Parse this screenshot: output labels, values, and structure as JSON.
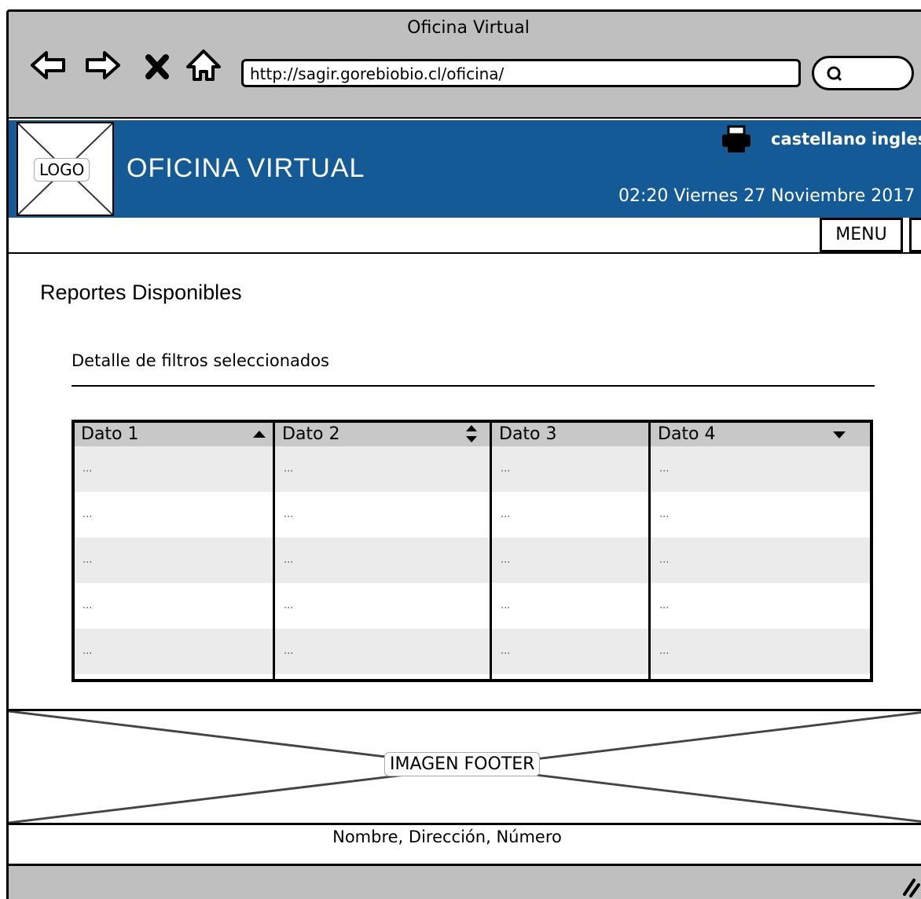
{
  "window": {
    "title": "Oficina Virtual"
  },
  "browser": {
    "url": "http://sagir.gorebiobio.cl/oficina/",
    "search_value": ""
  },
  "header": {
    "logo_label": "LOGO",
    "title": "OFICINA VIRTUAL",
    "languages": [
      "castellano",
      "ingles"
    ],
    "datetime": "02:20 Viernes 27 Noviembre 2017"
  },
  "menu": {
    "label": "MENU"
  },
  "main": {
    "title": "Reportes Disponibles",
    "filters_title": "Detalle de filtros seleccionados"
  },
  "table": {
    "columns": [
      "Dato 1",
      "Dato 2",
      "Dato 3",
      "Dato 4"
    ],
    "rows": [
      [
        "...",
        "...",
        "...",
        "..."
      ],
      [
        "...",
        "...",
        "...",
        "..."
      ],
      [
        "...",
        "...",
        "...",
        "..."
      ],
      [
        "...",
        "...",
        "...",
        "..."
      ],
      [
        "...",
        "...",
        "...",
        "..."
      ]
    ],
    "header_bg": "#c8c8c8",
    "stripe_bg": "#ebebeb"
  },
  "footer": {
    "image_label": "IMAGEN FOOTER",
    "text": "Nombre, Dirección, Número"
  },
  "colors": {
    "header_bg": "#145a96",
    "chrome_bg": "#bfbfbf"
  }
}
